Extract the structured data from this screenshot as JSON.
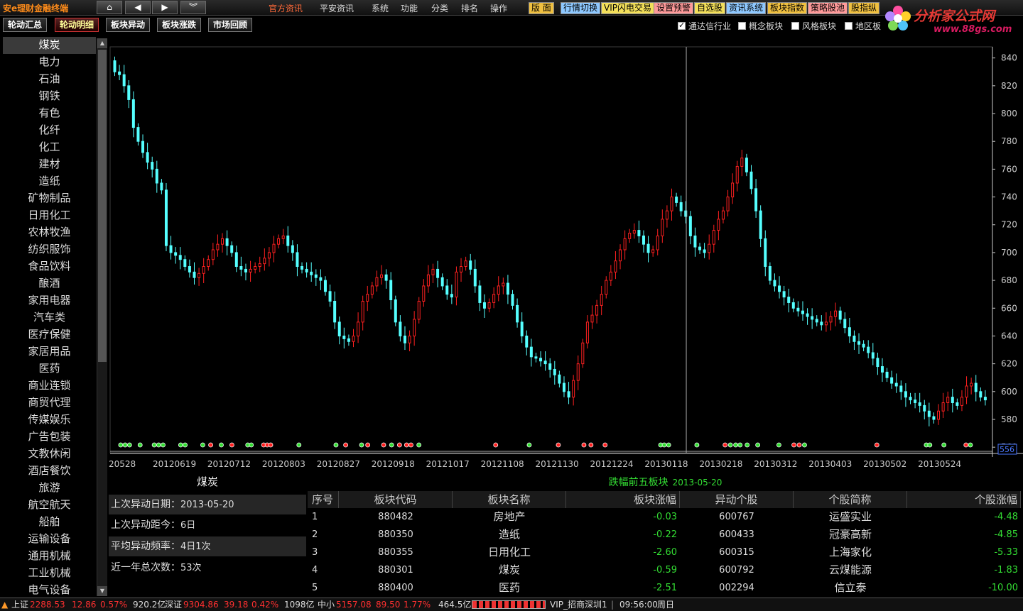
{
  "app": {
    "title": "安e理财金融终端"
  },
  "menu": [
    "官方资讯",
    "平安资讯",
    "系统",
    "功能",
    "分类",
    "排名",
    "操作"
  ],
  "toolbar": [
    {
      "label": "版  面",
      "color": "#f0c040"
    },
    {
      "label": "行情切换",
      "color": "#8ec8ff"
    },
    {
      "label": "VIP闪电交易",
      "color": "#f4e05a"
    },
    {
      "label": "设置预警",
      "color": "#ff9a9a"
    },
    {
      "label": "自选股",
      "color": "#f4e05a"
    },
    {
      "label": "资讯系统",
      "color": "#8ec8ff"
    },
    {
      "label": "板块指数",
      "color": "#f0c040"
    },
    {
      "label": "策略股池",
      "color": "#ff9a9a"
    },
    {
      "label": "股指纵",
      "color": "#f0c040"
    }
  ],
  "logo": {
    "text": "分析家公式网",
    "url": "www.88gs.com"
  },
  "tabs": [
    {
      "label": "轮动汇总",
      "active": false
    },
    {
      "label": "轮动明细",
      "active": true
    },
    {
      "label": "板块异动",
      "active": false
    },
    {
      "label": "板块涨跌",
      "active": false
    },
    {
      "label": "市场回顾",
      "active": false
    }
  ],
  "filters": [
    {
      "label": "通达信行业",
      "checked": true
    },
    {
      "label": "概念板块",
      "checked": false
    },
    {
      "label": "风格板块",
      "checked": false
    },
    {
      "label": "地区板",
      "checked": false
    }
  ],
  "sidebar": [
    "煤炭",
    "电力",
    "石油",
    "钢铁",
    "有色",
    "化纤",
    "化工",
    "建材",
    "造纸",
    "矿物制品",
    "日用化工",
    "农林牧渔",
    "纺织服饰",
    "食品饮料",
    "酿酒",
    "家用电器",
    "汽车类",
    "医疗保健",
    "家居用品",
    "医药",
    "商业连锁",
    "商贸代理",
    "传媒娱乐",
    "广告包装",
    "文教休闲",
    "酒店餐饮",
    "旅游",
    "航空航天",
    "船舶",
    "运输设备",
    "通用机械",
    "工业机械",
    "电气设备"
  ],
  "chart_data": {
    "type": "candlestick",
    "y_ticks": [
      840,
      820,
      800,
      780,
      760,
      740,
      720,
      700,
      680,
      660,
      640,
      620,
      600,
      580,
      560
    ],
    "ylim": [
      556,
      848
    ],
    "current_price_label": "556",
    "x_labels": [
      "20528",
      "20120619",
      "20120712",
      "20120803",
      "20120827",
      "20120918",
      "20121017",
      "20121108",
      "20121130",
      "20121224",
      "20130118",
      "20130218",
      "20130312",
      "20130403",
      "20130502",
      "20130524"
    ],
    "close_path": [
      830,
      828,
      820,
      810,
      790,
      780,
      772,
      765,
      760,
      750,
      745,
      705,
      700,
      698,
      695,
      690,
      686,
      682,
      685,
      690,
      695,
      702,
      706,
      710,
      705,
      700,
      690,
      688,
      686,
      688,
      690,
      692,
      696,
      700,
      706,
      710,
      712,
      705,
      700,
      690,
      688,
      686,
      684,
      682,
      680,
      672,
      665,
      650,
      640,
      638,
      636,
      640,
      650,
      665,
      670,
      676,
      682,
      684,
      680,
      666,
      650,
      640,
      635,
      640,
      652,
      665,
      676,
      684,
      688,
      682,
      676,
      670,
      668,
      686,
      690,
      694,
      688,
      676,
      664,
      660,
      664,
      670,
      676,
      678,
      670,
      662,
      650,
      640,
      632,
      625,
      624,
      622,
      620,
      616,
      612,
      606,
      600,
      596,
      608,
      620,
      635,
      650,
      655,
      662,
      670,
      680,
      686,
      694,
      702,
      710,
      714,
      716,
      712,
      706,
      700,
      702,
      712,
      724,
      730,
      740,
      736,
      730,
      726,
      712,
      704,
      702,
      700,
      706,
      716,
      724,
      730,
      740,
      750,
      762,
      768,
      758,
      746,
      730,
      710,
      690,
      680,
      676,
      672,
      668,
      664,
      660,
      658,
      656,
      654,
      652,
      650,
      648,
      650,
      654,
      658,
      652,
      646,
      640,
      636,
      634,
      632,
      628,
      624,
      618,
      614,
      610,
      606,
      604,
      600,
      596,
      594,
      592,
      590,
      586,
      582,
      580,
      586,
      592,
      596,
      592,
      590,
      596,
      604,
      606,
      600,
      596,
      594
    ],
    "signals": [
      {
        "x": 0.012,
        "c": "g"
      },
      {
        "x": 0.017,
        "c": "g"
      },
      {
        "x": 0.022,
        "c": "g"
      },
      {
        "x": 0.034,
        "c": "g"
      },
      {
        "x": 0.05,
        "c": "g"
      },
      {
        "x": 0.055,
        "c": "g"
      },
      {
        "x": 0.06,
        "c": "g"
      },
      {
        "x": 0.08,
        "c": "g"
      },
      {
        "x": 0.085,
        "c": "g"
      },
      {
        "x": 0.105,
        "c": "g"
      },
      {
        "x": 0.114,
        "c": "r"
      },
      {
        "x": 0.126,
        "c": "g"
      },
      {
        "x": 0.138,
        "c": "r"
      },
      {
        "x": 0.156,
        "c": "g"
      },
      {
        "x": 0.16,
        "c": "g"
      },
      {
        "x": 0.174,
        "c": "r"
      },
      {
        "x": 0.178,
        "c": "r"
      },
      {
        "x": 0.182,
        "c": "r"
      },
      {
        "x": 0.214,
        "c": "g"
      },
      {
        "x": 0.256,
        "c": "g"
      },
      {
        "x": 0.267,
        "c": "r"
      },
      {
        "x": 0.285,
        "c": "g"
      },
      {
        "x": 0.292,
        "c": "r"
      },
      {
        "x": 0.31,
        "c": "r"
      },
      {
        "x": 0.319,
        "c": "g"
      },
      {
        "x": 0.328,
        "c": "r"
      },
      {
        "x": 0.336,
        "c": "r"
      },
      {
        "x": 0.341,
        "c": "r"
      },
      {
        "x": 0.35,
        "c": "g"
      },
      {
        "x": 0.437,
        "c": "r"
      },
      {
        "x": 0.475,
        "c": "g"
      },
      {
        "x": 0.508,
        "c": "r"
      },
      {
        "x": 0.537,
        "c": "r"
      },
      {
        "x": 0.545,
        "c": "r"
      },
      {
        "x": 0.561,
        "c": "r"
      },
      {
        "x": 0.624,
        "c": "g"
      },
      {
        "x": 0.628,
        "c": "g"
      },
      {
        "x": 0.633,
        "c": "g"
      },
      {
        "x": 0.665,
        "c": "g"
      },
      {
        "x": 0.697,
        "c": "r"
      },
      {
        "x": 0.703,
        "c": "g"
      },
      {
        "x": 0.709,
        "c": "g"
      },
      {
        "x": 0.714,
        "c": "g"
      },
      {
        "x": 0.722,
        "c": "g"
      },
      {
        "x": 0.734,
        "c": "g"
      },
      {
        "x": 0.758,
        "c": "g"
      },
      {
        "x": 0.775,
        "c": "r"
      },
      {
        "x": 0.781,
        "c": "r"
      },
      {
        "x": 0.787,
        "c": "g"
      },
      {
        "x": 0.869,
        "c": "r"
      },
      {
        "x": 0.925,
        "c": "g"
      },
      {
        "x": 0.929,
        "c": "g"
      },
      {
        "x": 0.945,
        "c": "g"
      },
      {
        "x": 0.97,
        "c": "r"
      },
      {
        "x": 0.975,
        "c": "g"
      }
    ],
    "crosshair_x": 0.653
  },
  "info": {
    "title": "煤炭",
    "rows": [
      {
        "label": "上次异动日期：",
        "value": "2013-05-20"
      },
      {
        "label": "上次异动距今：",
        "value": "6日"
      },
      {
        "label": "平均异动频率：",
        "value": "4日1次"
      },
      {
        "label": "近一年总次数：",
        "value": "53次"
      }
    ]
  },
  "table": {
    "title": "跌幅前五板块",
    "date": "2013-05-20",
    "headers": [
      "序号",
      "板块代码",
      "板块名称",
      "板块涨幅",
      "异动个股",
      "个股简称",
      "个股涨幅"
    ],
    "rows": [
      [
        "1",
        "880482",
        "房地产",
        "-0.03",
        "600767",
        "运盛实业",
        "-4.48"
      ],
      [
        "2",
        "880350",
        "造纸",
        "-0.22",
        "600433",
        "冠豪高新",
        "-4.85"
      ],
      [
        "3",
        "880355",
        "日用化工",
        "-2.60",
        "600315",
        "上海家化",
        "-5.33"
      ],
      [
        "4",
        "880301",
        "煤炭",
        "-0.59",
        "600792",
        "云煤能源",
        "-1.83"
      ],
      [
        "5",
        "880400",
        "医药",
        "-2.51",
        "002294",
        "信立泰",
        "-10.00"
      ]
    ]
  },
  "status": {
    "sh_label": "上证",
    "sh_val": "2288.53",
    "sh_chg": "12.86",
    "sh_pct": "0.57%",
    "sh_amt": "920.2亿",
    "sz_label": "深证",
    "sz_val": "9304.86",
    "sz_chg": "39.18",
    "sz_pct": "0.42%",
    "sz_amt": "1098亿",
    "zx_label": "中小",
    "zx_val": "5157.08",
    "zx_chg": "89.50",
    "zx_pct": "1.77%",
    "zx_amt": "464.5亿",
    "server": "VIP_招商深圳1",
    "time": "09:56:00",
    "weekday": "周日"
  },
  "colors": {
    "up": "#ff2020",
    "down": "#55ffff",
    "green": "#33dd33"
  }
}
